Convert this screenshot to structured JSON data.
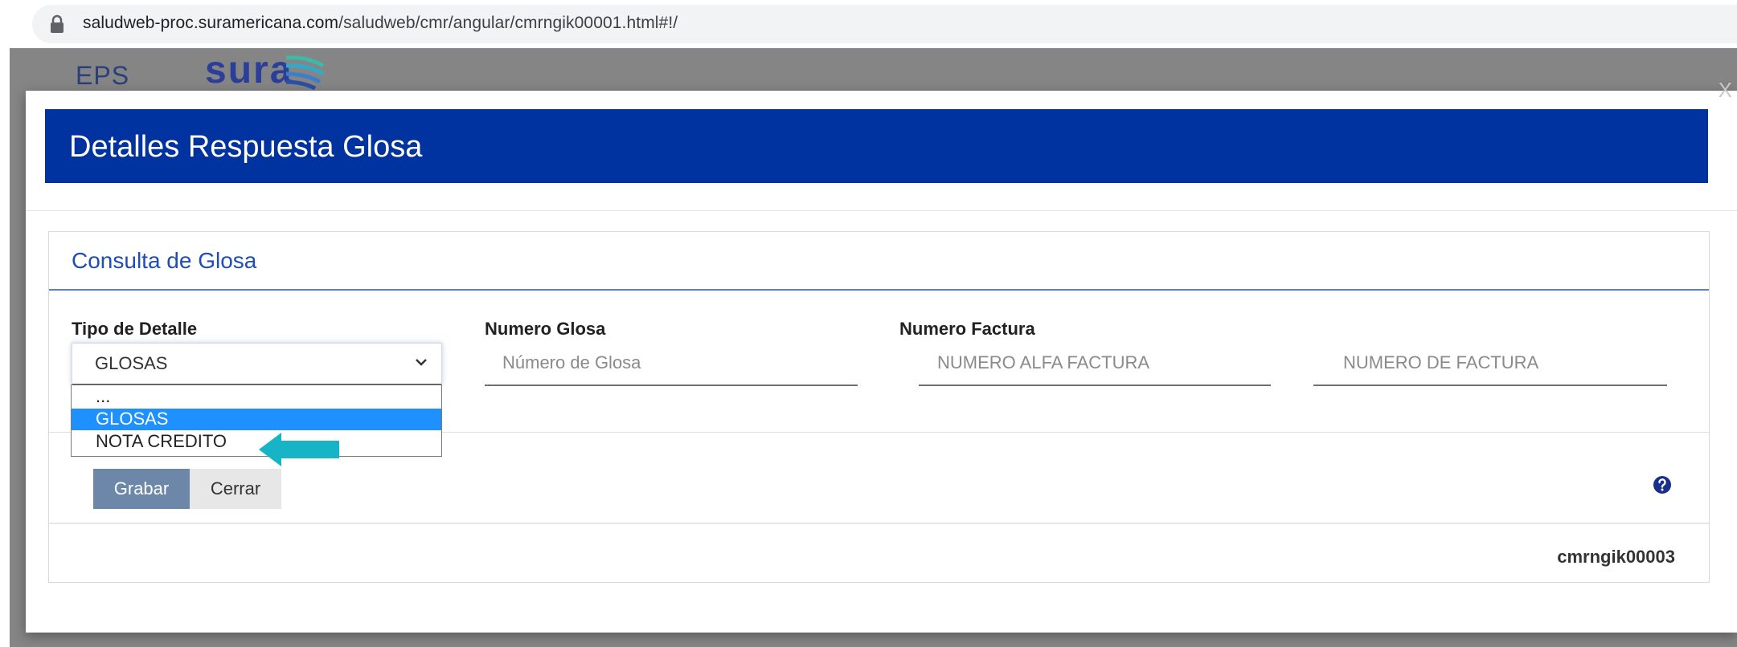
{
  "browser": {
    "url_host": "saludweb-proc.suramericana.com",
    "url_path": "/saludweb/cmr/angular/cmrngik00001.html#!/"
  },
  "brand": {
    "eps": "EPS",
    "sura": "sura",
    "primary_color": "#0033a0"
  },
  "modal": {
    "title": "Detalles Respuesta Glosa",
    "close_symbol": "X",
    "panel": {
      "title": "Consulta de Glosa",
      "fields": {
        "tipo_detalle_label": "Tipo de Detalle",
        "tipo_detalle_value": "GLOSAS",
        "numero_glosa_label": "Numero Glosa",
        "numero_glosa_placeholder": "Número de Glosa",
        "numero_factura_label": "Numero Factura",
        "alfa_factura_placeholder": "NUMERO ALFA FACTURA",
        "numero_factura_placeholder": "NUMERO DE FACTURA"
      },
      "dropdown_options": [
        "...",
        "GLOSAS",
        "NOTA CREDITO"
      ],
      "dropdown_selected": "GLOSAS",
      "buttons": {
        "save": "Grabar",
        "close": "Cerrar"
      },
      "help_icon": "question-circle-icon",
      "form_code": "cmrngik00003"
    }
  },
  "annotation": {
    "arrow_color": "#17b3c7"
  }
}
